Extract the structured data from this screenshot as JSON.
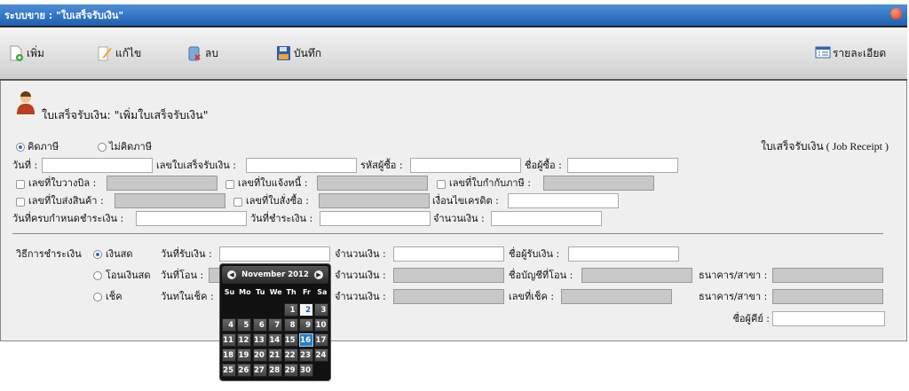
{
  "window": {
    "title": "ระบบขาย : \"ใบเสร็จรับเงิน\""
  },
  "toolbar": {
    "add": "เพิ่ม",
    "edit": "แก้ไข",
    "delete": "ลบ",
    "save": "บันทึก",
    "details": "รายละเอียด"
  },
  "header": {
    "title": "ใบเสร็จรับเงิน: \"เพิ่มใบเสร็จรับเงิน\"",
    "doc_type": "ใบเสร็จรับเงิน ( Job Receipt )"
  },
  "tax": {
    "with_tax": "คิดภาษี",
    "without_tax": "ไม่คิดภาษี",
    "selected": "with_tax"
  },
  "fields": {
    "date": "วันที่ :",
    "receipt_no": "เลขใบเสร็จรับเงิน :",
    "buyer_code": "รหัสผู้ซื้อ :",
    "buyer_name": "ชื่อผู้ซื้อ :",
    "billing_no": "เลขที่ใบวางบิล :",
    "invoice_no": "เลขที่ใบแจ้งหนี้ :",
    "tax_invoice_no": "เลขที่ใบกำกับภาษี :",
    "delivery_no": "เลขที่ใบส่งสินค้า :",
    "po_no": "เลขที่ใบสั่งซื้อ :",
    "credit_terms": "เงื่อนไขเครดิต :",
    "due_date": "วันที่ครบกำหนดชำระเงิน :",
    "payment_date": "วันที่ชำระเงิน :",
    "amount": "จำนวนเงิน :"
  },
  "payment": {
    "label": "วิธีการชำระเงิน",
    "cash": "เงินสด",
    "transfer": "โอนเงินสด",
    "cheque": "เช็ค",
    "selected": "cash",
    "receive_date": "วันที่รับเงิน :",
    "transfer_date": "วันที่โอน :",
    "cheque_date": "วันทในเช็ค :",
    "amount": "จำนวนเงิน :",
    "receiver_name": "ชื่อผู้รับเงิน :",
    "account_name": "ชื่อบัญชีที่โอน :",
    "cheque_no": "เลขที่เช็ค :",
    "bank_branch": "ธนาคาร/สาขา :",
    "keyed_by": "ชื่อผู้คีย์ :"
  },
  "calendar": {
    "month_label": "November 2012",
    "weekdays": [
      "Su",
      "Mo",
      "Tu",
      "We",
      "Th",
      "Fr",
      "Sa"
    ],
    "first_weekday": 4,
    "days_in_month": 30,
    "highlighted_day": 2,
    "selected_day": 16,
    "prev": "◀",
    "next": "▶"
  }
}
